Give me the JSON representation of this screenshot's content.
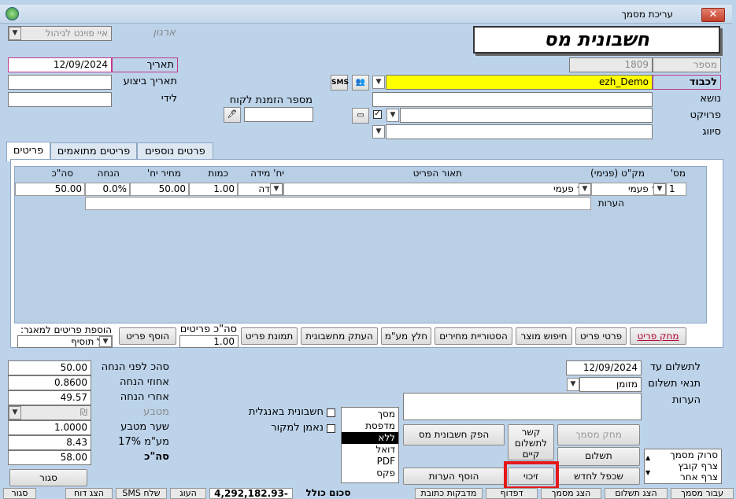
{
  "window": {
    "title": "עריכת מסמך",
    "close_icon": "close-icon"
  },
  "header": {
    "doc_title": "חשבונית מס",
    "org_label": "ארגון",
    "org_value": "איי פוינט לניהול",
    "number_label": "מספר",
    "number_value": "1809",
    "date_label": "תאריך",
    "date_value": "12/09/2024",
    "exec_date_label": "תאריך ביצוע",
    "exec_date_value": "",
    "attention_label": "לידי",
    "attention_value": "",
    "to_label": "לכבוד",
    "to_value": "ezh_Demo",
    "subject_label": "נושא",
    "subject_value": "",
    "project_label": "פרויקט",
    "project_value": "",
    "classification_label": "סיווג",
    "classification_value": "",
    "order_no_label": "מספר הזמנת לקוח",
    "order_no_value": "",
    "sms_label": "SMS"
  },
  "tabs": [
    {
      "label": "פריטים"
    },
    {
      "label": "פריטים מתואמים"
    },
    {
      "label": "פרטים נוספים"
    }
  ],
  "items_grid": {
    "columns": [
      "מס'",
      "מק\"ט (פנימי)",
      "תאור הפריט",
      "יח' מידה",
      "כמות",
      "מחיר יח'",
      "הנחה",
      "סה\"כ"
    ],
    "rows": [
      {
        "num": "1",
        "sku": "חד פעמי",
        "desc": "חד פעמי",
        "unit": "יחידה",
        "qty": "1.00",
        "price": "50.00",
        "discount": "0.0%",
        "total": "50.00"
      }
    ],
    "notes_label": "הערות",
    "notes_value": ""
  },
  "grid_buttons": {
    "delete_item": "מחק פריט",
    "item_details": "פרטי פריט",
    "product_search": "חיפוש מוצר",
    "price_history": "הסטוריית מחירים",
    "extract_vat": "חלץ מע\"מ",
    "copy_from_invoice": "העתק מחשבונית",
    "item_image": "תמונת פריט",
    "items_total_label": "סה\"כ פריטים",
    "items_total_value": "1.00",
    "add_item": "הוסף פריט",
    "add_to_repo_label": "הוספת פריטים למאגר:",
    "add_to_repo_value": "אל תוסיף"
  },
  "totals": {
    "before_discount_label": "סהכ לפני הנחה",
    "before_discount_value": "50.00",
    "discount_pct_label": "אחוזי הנחה",
    "discount_pct_value": "0.8600",
    "after_discount_label": "אחרי הנחה",
    "after_discount_value": "49.57",
    "currency_label": "מטבע",
    "currency_value": "₪",
    "rate_label": "שער מטבע",
    "rate_value": "1.0000",
    "vat_label": "מע\"מ 17%",
    "vat_value": "8.43",
    "total_label": "סה\"כ",
    "total_value": "58.00"
  },
  "options": {
    "english_invoice": "חשבונית באנגלית",
    "true_copy": "נאמן למקור"
  },
  "output_list": [
    "מסך",
    "מדפסת",
    "ללא",
    "דואל",
    "PDF",
    "פקס"
  ],
  "output_selected": "ללא",
  "payment": {
    "due_label": "לתשלום עד",
    "due_value": "12/09/2024",
    "terms_label": "תנאי תשלום",
    "terms_value": "מזומן",
    "notes_label": "הערות",
    "notes_value": ""
  },
  "actions": {
    "issue_invoice": "הפק חשבונית מס",
    "link_payment": "קשר לתשלום קיים",
    "delete_doc": "מחק מסמך",
    "payment": "תשלום",
    "duplicate": "שכפל לחדש",
    "credit": "זיכוי",
    "add_notes": "הוסף הערות",
    "close": "סגור"
  },
  "attachments": [
    "סרוק מסמך",
    "צרף קובץ",
    "צרף אחר"
  ],
  "statusbar": {
    "total_label": "סכום כולל",
    "total_value": "-4,292,182.93",
    "items": [
      "סגור",
      "הצג דוח",
      "שלח SMS",
      "העוג",
      "מדבקות כתובת",
      "דפדוף",
      "הצג מסמך",
      "הצג תשלום",
      "עבור מסמך"
    ]
  }
}
